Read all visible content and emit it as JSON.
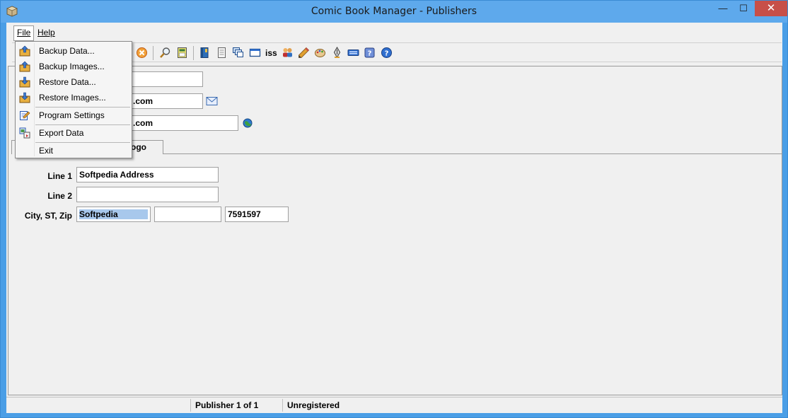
{
  "window": {
    "title": "Comic Book Manager - Publishers",
    "minimize": "—",
    "maximize": "☐",
    "close": "✕"
  },
  "menubar": {
    "file": "File",
    "help": "Help"
  },
  "file_menu": {
    "items": [
      {
        "label": "Backup Data...",
        "icon": "backup-data-icon"
      },
      {
        "label": "Backup Images...",
        "icon": "backup-images-icon"
      },
      {
        "label": "Restore Data...",
        "icon": "restore-data-icon"
      },
      {
        "label": "Restore Images...",
        "icon": "restore-images-icon"
      },
      {
        "label": "Program Settings",
        "icon": "settings-icon"
      },
      {
        "label": "Export Data",
        "icon": "export-icon"
      },
      {
        "label": "Exit",
        "icon": ""
      }
    ]
  },
  "toolbar": {
    "iss_label": "iss"
  },
  "publisher": {
    "email_value": ".com",
    "website_value": ".com"
  },
  "tabs": {
    "logo_tab": "ogo"
  },
  "address": {
    "line1_label": "Line 1",
    "line1_value": "Softpedia Address",
    "line2_label": "Line 2",
    "line2_value": "",
    "city_label": "City, ST, Zip",
    "city_value": "Softpedia",
    "state_value": "",
    "zip_value": "7591597"
  },
  "status": {
    "record": "Publisher 1 of 1",
    "registration": "Unregistered"
  },
  "colors": {
    "titlebar": "#5ea9ec",
    "close": "#c74f48",
    "highlight": "#a8c8ec"
  }
}
